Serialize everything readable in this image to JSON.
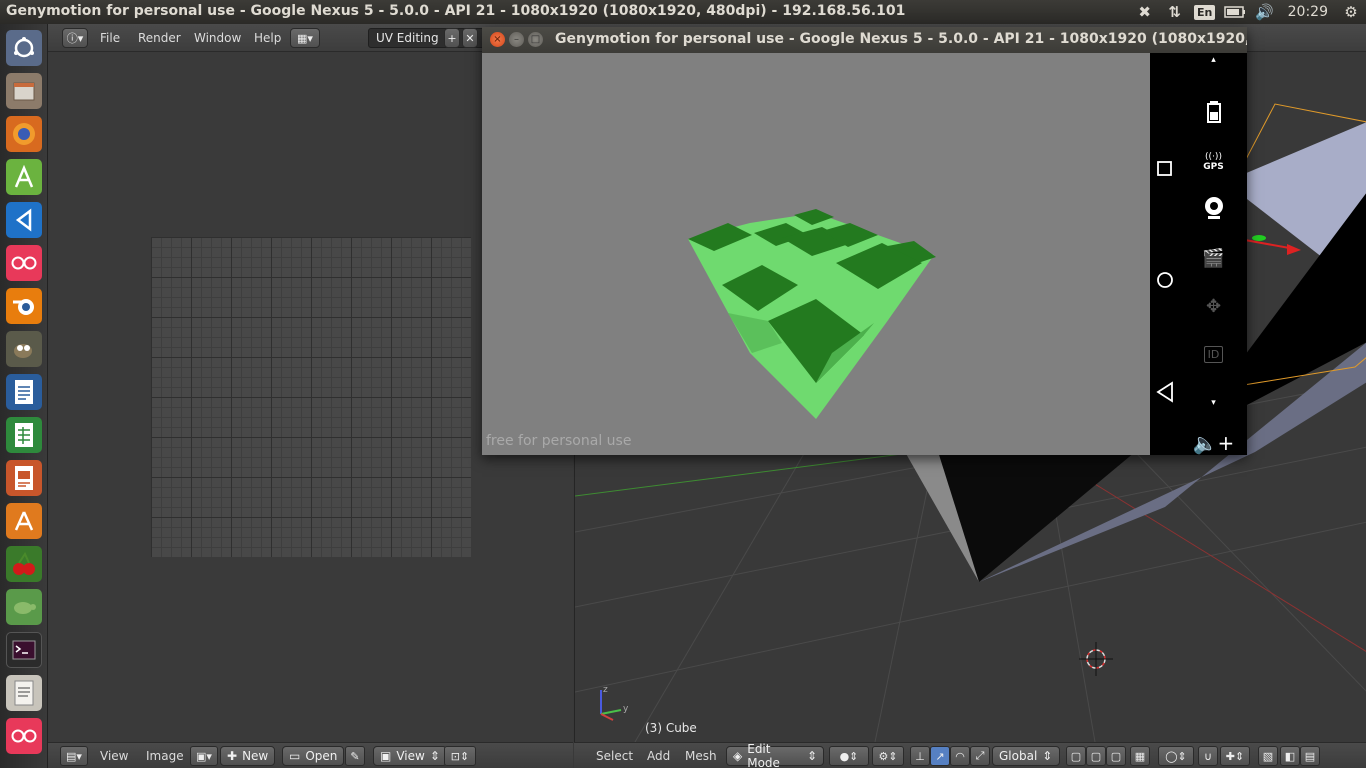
{
  "top_panel": {
    "window_title": "Genymotion for personal use - Google Nexus 5 - 5.0.0 - API 21 - 1080x1920 (1080x1920, 480dpi) - 192.168.56.101",
    "language": "En",
    "clock": "20:29"
  },
  "launcher": {
    "items": [
      "dash-home",
      "files",
      "firefox",
      "android-studio",
      "vscode",
      "flickr",
      "blender",
      "gimp",
      "writer",
      "calc",
      "impress",
      "software-center",
      "cherrytree",
      "turtle",
      "terminal",
      "text-editor",
      "flickr-2"
    ]
  },
  "blender": {
    "menus": [
      "File",
      "Render",
      "Window",
      "Help"
    ],
    "layout": "UV Editing",
    "uv_header": {
      "menus": [
        "View",
        "Image"
      ],
      "new_label": "New",
      "open_label": "Open",
      "view_label": "View"
    },
    "viewport": {
      "object_label": "(3) Cube",
      "menus": [
        "Select",
        "Add",
        "Mesh"
      ],
      "mode": "Edit Mode",
      "orientation": "Global"
    }
  },
  "genymotion": {
    "title": "Genymotion for personal use - Google Nexus 5 - 5.0.0 - API 21 - 1080x1920 (1080x1920, 480dpi) - 192.168.56.101",
    "watermark": "free for personal use",
    "gps_label": "GPS",
    "id_label": "ID"
  },
  "colors": {
    "cube_light": "#6fda6f",
    "cube_dark": "#237a1f",
    "screen_bg": "#808080"
  }
}
